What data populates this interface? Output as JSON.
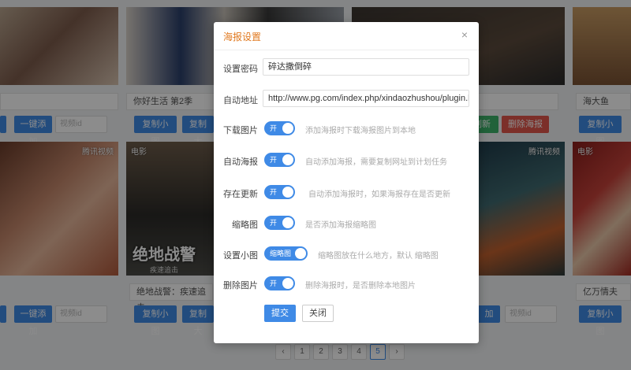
{
  "background": {
    "row1": [
      {
        "title": "",
        "buttons": [
          "一键添加"
        ],
        "input": "视频id"
      },
      {
        "title": "你好生活 第2季",
        "buttons": [
          "复制小图",
          "复制大"
        ]
      },
      {
        "buttons_right": [
          "刷新",
          "删除海报"
        ]
      },
      {
        "title": "海大鱼",
        "buttons": [
          "复制小图"
        ]
      }
    ],
    "row2": [
      {
        "tag_right": "腾讯视频",
        "buttons": [
          "一键添加"
        ],
        "input": "视频id"
      },
      {
        "tag_left": "电影",
        "poster_title": "绝地战警",
        "poster_sub": "疾速追击",
        "title": "绝地战警：疾速追击",
        "buttons": [
          "复制小图",
          "复制大"
        ]
      },
      {
        "tag_right": "腾讯视频",
        "buttons": [
          "加"
        ],
        "input": "视频id"
      },
      {
        "tag_left": "电影",
        "title": "亿万情夫",
        "buttons": [
          "复制小图"
        ]
      }
    ],
    "pagination": [
      "‹",
      "1",
      "2",
      "3",
      "4",
      "5",
      "›"
    ],
    "pagination_active": "5"
  },
  "modal": {
    "title": "海报设置",
    "close_glyph": "×",
    "rows": {
      "password": {
        "label": "设置密码",
        "value": "碎达撒倒碎"
      },
      "auto_url": {
        "label": "自动地址",
        "value": "http://www.pg.com/index.php/xindaozhushou/plugin.html?plugin=poster"
      },
      "download": {
        "label": "下载图片",
        "switch": "开",
        "hint": "添加海报时下载海报图片到本地"
      },
      "auto_poster": {
        "label": "自动海报",
        "switch": "开",
        "hint": "自动添加海报，需要复制网址到计划任务"
      },
      "update": {
        "label": "存在更新",
        "switch": "开",
        "hint": "自动添加海报时，如果海报存在是否更新"
      },
      "thumb": {
        "label": "缩略图",
        "switch": "开",
        "hint": "是否添加海报缩略图"
      },
      "small": {
        "label": "设置小图",
        "switch": "缩略图",
        "hint": "缩略图放在什么地方，默认 缩略图"
      },
      "delete": {
        "label": "删除图片",
        "switch": "开",
        "hint": "删除海报时，是否删除本地图片"
      }
    },
    "submit_label": "提交",
    "close_label": "关闭"
  },
  "colors": {
    "accent": "#3f8ae6",
    "title": "#e0781e",
    "green": "#3db36a",
    "red": "#e2574c"
  }
}
